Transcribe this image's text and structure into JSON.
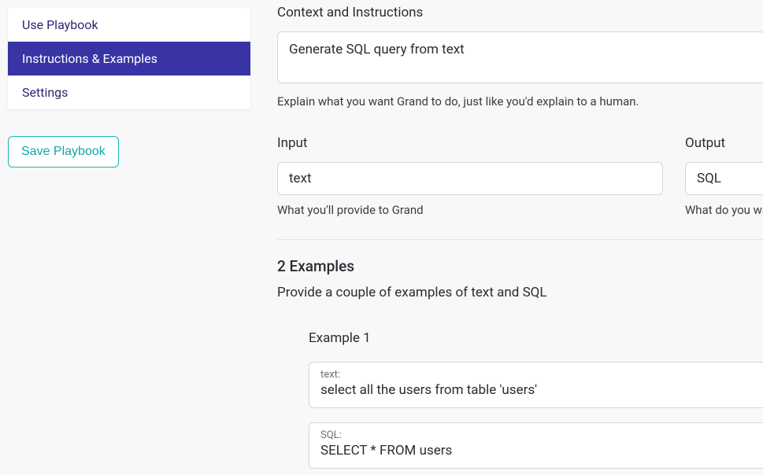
{
  "sidebar": {
    "items": [
      {
        "label": "Use Playbook",
        "active": false
      },
      {
        "label": "Instructions & Examples",
        "active": true
      },
      {
        "label": "Settings",
        "active": false
      }
    ],
    "save_label": "Save Playbook"
  },
  "context": {
    "label": "Context and Instructions",
    "value": "Generate SQL query from text",
    "helper": "Explain what you want Grand to do, just like you'd explain to a human."
  },
  "input": {
    "label": "Input",
    "value": "text",
    "helper": "What you'll provide to Grand"
  },
  "output": {
    "label": "Output",
    "value": "SQL",
    "helper": "What do you wa"
  },
  "examples": {
    "heading": "2 Examples",
    "sub": "Provide a couple of examples of text and SQL",
    "list": [
      {
        "title": "Example 1",
        "text_label": "text:",
        "text_value": "select all the users from table 'users'",
        "sql_label": "SQL:",
        "sql_value": "SELECT * FROM users"
      }
    ]
  }
}
